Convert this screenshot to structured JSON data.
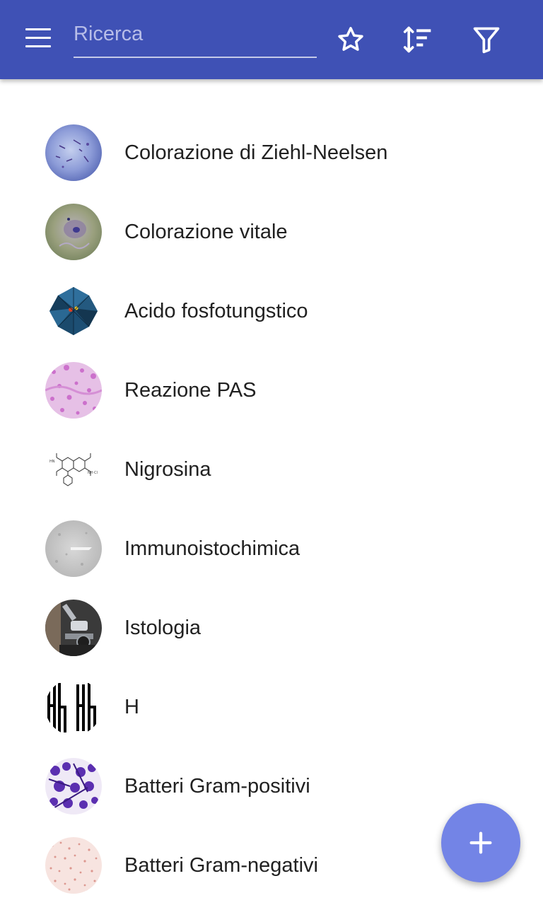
{
  "header": {
    "search_placeholder": "Ricerca",
    "icons": {
      "menu": "menu-icon",
      "favorites": "star-outline-icon",
      "sort": "sort-icon",
      "filter": "filter-icon"
    },
    "accent_color": "#3f51b5"
  },
  "items": [
    {
      "label": "Colorazione di Ziehl-Neelsen",
      "thumb": "micrograph-blue-thumbnail"
    },
    {
      "label": "Colorazione vitale",
      "thumb": "micrograph-green-thumbnail"
    },
    {
      "label": "Acido fosfotungstico",
      "thumb": "polyhedron-molecule-thumbnail"
    },
    {
      "label": "Reazione PAS",
      "thumb": "tissue-pink-thumbnail"
    },
    {
      "label": "Nigrosina",
      "thumb": "chemical-structure-thumbnail"
    },
    {
      "label": "Immunoistochimica",
      "thumb": "grey-tissue-thumbnail"
    },
    {
      "label": "Istologia",
      "thumb": "microscope-thumbnail"
    },
    {
      "label": "H",
      "thumb": "letter-h-glyphs-thumbnail"
    },
    {
      "label": "Batteri Gram-positivi",
      "thumb": "purple-bacteria-thumbnail"
    },
    {
      "label": "Batteri Gram-negativi",
      "thumb": "pink-bacteria-thumbnail"
    }
  ],
  "fab": {
    "icon": "plus-icon",
    "color": "#7384e6"
  }
}
